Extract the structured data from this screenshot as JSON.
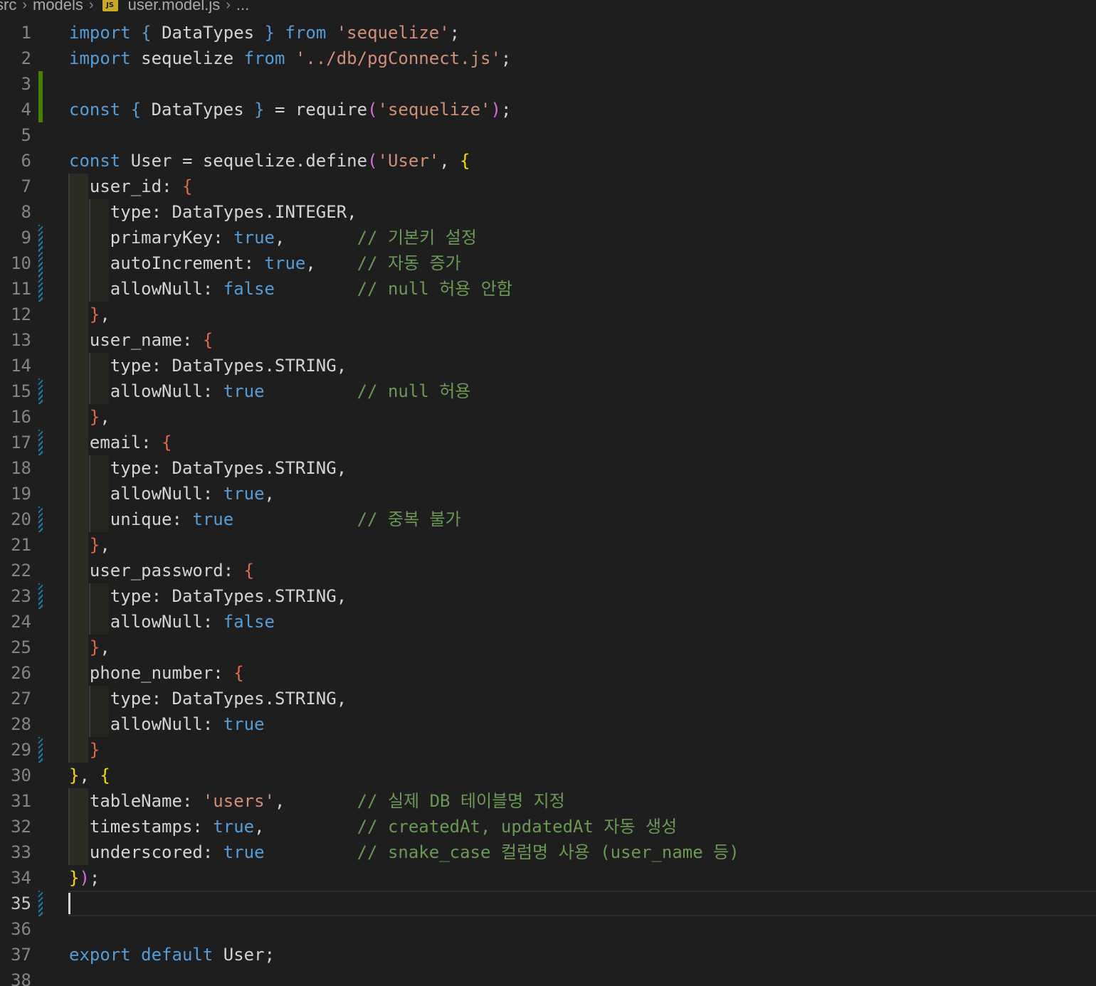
{
  "breadcrumb": {
    "segments": [
      "src",
      "models"
    ],
    "file_icon_label": "JS",
    "file_name": "user.model.js",
    "more": "..."
  },
  "editor": {
    "current_line": 35,
    "lines": [
      {
        "n": "1",
        "text": "import { DataTypes } from 'sequelize';"
      },
      {
        "n": "2",
        "text": "import sequelize from '../db/pgConnect.js';"
      },
      {
        "n": "3",
        "text": ""
      },
      {
        "n": "4",
        "text": "const { DataTypes } = require('sequelize');"
      },
      {
        "n": "5",
        "text": ""
      },
      {
        "n": "6",
        "text": "const User = sequelize.define('User', {"
      },
      {
        "n": "7",
        "text": "  user_id: {"
      },
      {
        "n": "8",
        "text": "    type: DataTypes.INTEGER,"
      },
      {
        "n": "9",
        "text": "    primaryKey: true,       // 기본키 설정"
      },
      {
        "n": "10",
        "text": "    autoIncrement: true,    // 자동 증가"
      },
      {
        "n": "11",
        "text": "    allowNull: false        // null 허용 안함"
      },
      {
        "n": "12",
        "text": "  },"
      },
      {
        "n": "13",
        "text": "  user_name: {"
      },
      {
        "n": "14",
        "text": "    type: DataTypes.STRING,"
      },
      {
        "n": "15",
        "text": "    allowNull: true         // null 허용"
      },
      {
        "n": "16",
        "text": "  },"
      },
      {
        "n": "17",
        "text": "  email: {"
      },
      {
        "n": "18",
        "text": "    type: DataTypes.STRING,"
      },
      {
        "n": "19",
        "text": "    allowNull: true,"
      },
      {
        "n": "20",
        "text": "    unique: true            // 중복 불가"
      },
      {
        "n": "21",
        "text": "  },"
      },
      {
        "n": "22",
        "text": "  user_password: {"
      },
      {
        "n": "23",
        "text": "    type: DataTypes.STRING,"
      },
      {
        "n": "24",
        "text": "    allowNull: false"
      },
      {
        "n": "25",
        "text": "  },"
      },
      {
        "n": "26",
        "text": "  phone_number: {"
      },
      {
        "n": "27",
        "text": "    type: DataTypes.STRING,"
      },
      {
        "n": "28",
        "text": "    allowNull: true"
      },
      {
        "n": "29",
        "text": "  }"
      },
      {
        "n": "30",
        "text": "}, {"
      },
      {
        "n": "31",
        "text": "  tableName: 'users',       // 실제 DB 테이블명 지정"
      },
      {
        "n": "32",
        "text": "  timestamps: true,         // createdAt, updatedAt 자동 생성"
      },
      {
        "n": "33",
        "text": "  underscored: true         // snake_case 컬럼명 사용 (user_name 등)"
      },
      {
        "n": "34",
        "text": "});"
      },
      {
        "n": "35",
        "text": ""
      },
      {
        "n": "36",
        "text": ""
      },
      {
        "n": "37",
        "text": "export default User;"
      },
      {
        "n": "38",
        "text": ""
      }
    ]
  },
  "colors": {
    "background": "#1e1e1e",
    "keyword": "#569cd6",
    "string": "#ce9178",
    "comment": "#6a9955",
    "git_added": "#487e02",
    "git_modified": "#1b81a8"
  }
}
